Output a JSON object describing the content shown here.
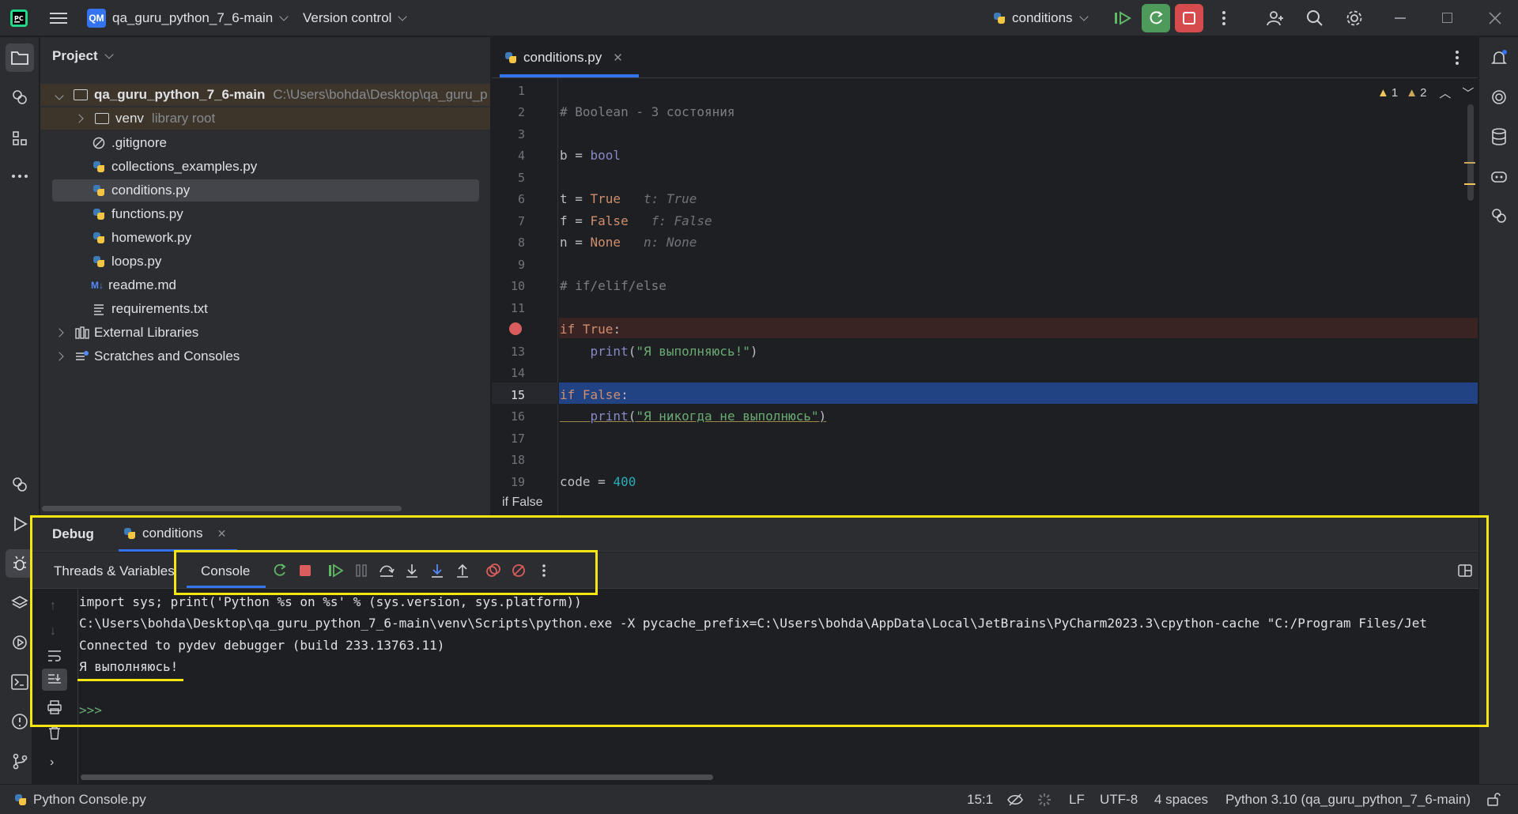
{
  "title_bar": {
    "project_badge": "QM",
    "project_name": "qa_guru_python_7_6-main",
    "version_control": "Version control",
    "run_config": "conditions"
  },
  "project_panel": {
    "title": "Project",
    "root": {
      "name": "qa_guru_python_7_6-main",
      "path": "C:\\Users\\bohda\\Desktop\\qa_guru_p"
    },
    "items": [
      {
        "name": "venv",
        "suffix": "library root"
      },
      {
        "name": ".gitignore"
      },
      {
        "name": "collections_examples.py"
      },
      {
        "name": "conditions.py"
      },
      {
        "name": "functions.py"
      },
      {
        "name": "homework.py"
      },
      {
        "name": "loops.py"
      },
      {
        "name": "readme.md"
      },
      {
        "name": "requirements.txt"
      },
      {
        "name": "External Libraries"
      },
      {
        "name": "Scratches and Consoles"
      }
    ]
  },
  "editor": {
    "tab_label": "conditions.py",
    "warnings": "1",
    "weak_warnings": "2",
    "line_numbers": [
      "1",
      "2",
      "3",
      "4",
      "5",
      "6",
      "7",
      "8",
      "9",
      "10",
      "11",
      "",
      "13",
      "14",
      "15",
      "16",
      "17",
      "18",
      "19"
    ],
    "lines": {
      "l2": "# Boolean - 3 состояния",
      "l4a": "b = ",
      "l4b": "bool",
      "l6a": "t = ",
      "l6b": "True",
      "l6h": "t: True",
      "l7a": "f = ",
      "l7b": "False",
      "l7h": "f: False",
      "l8a": "n = ",
      "l8b": "None",
      "l8h": "n: None",
      "l10": "# if/elif/else",
      "l12a": "if ",
      "l12b": "True",
      "l12c": ":",
      "l13a": "print",
      "l13b": "(",
      "l13c": "\"Я выполняюсь!\"",
      "l13d": ")",
      "l15a": "if ",
      "l15b": "False",
      "l15c": ":",
      "l16a": "print",
      "l16b": "(",
      "l16c": "\"Я никогда не выполнюсь\"",
      "l16d": ")",
      "l19a": "code = ",
      "l19b": "400"
    },
    "breadcrumb": "if False"
  },
  "debug": {
    "title": "Debug",
    "session_tab": "conditions",
    "threads_tab": "Threads & Variables",
    "console_tab": "Console",
    "console_lines": [
      "import sys; print('Python %s on %s' % (sys.version, sys.platform))",
      "C:\\Users\\bohda\\Desktop\\qa_guru_python_7_6-main\\venv\\Scripts\\python.exe -X pycache_prefix=C:\\Users\\bohda\\AppData\\Local\\JetBrains\\PyCharm2023.3\\cpython-cache \"C:/Program Files/Jet",
      "Connected to pydev debugger (build 233.13763.11)",
      "Я выполняюсь!"
    ],
    "prompt": ">>>"
  },
  "status_bar": {
    "left": "Python Console.py",
    "position": "15:1",
    "line_sep": "LF",
    "encoding": "UTF-8",
    "indent": "4 spaces",
    "interpreter": "Python 3.10 (qa_guru_python_7_6-main)"
  },
  "colors": {
    "highlight_box": "#f5e611",
    "breakpoint_line": "#3a2323",
    "current_line": "#214283",
    "accent": "#3574f0"
  }
}
